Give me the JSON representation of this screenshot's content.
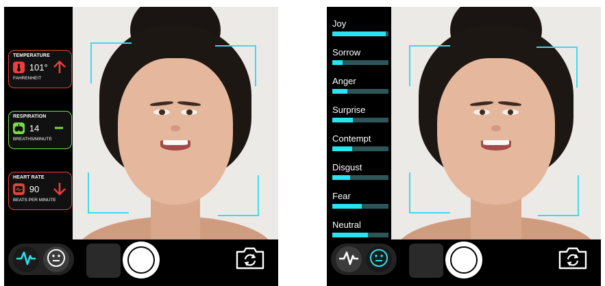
{
  "vitals_screen": {
    "temperature": {
      "title": "TEMPERATURE",
      "value": "101°",
      "unit": "FAHRENHEIT",
      "trend": "up-arrow-icon"
    },
    "respiration": {
      "title": "RESPIRATION",
      "value": "14",
      "unit": "BREATHS/MINUTE",
      "trend": "dash-icon"
    },
    "heart_rate": {
      "title": "HEART RATE",
      "value": "90",
      "unit": "BEATS PER MINUTE",
      "trend": "down-arrow-icon"
    }
  },
  "emotions_screen": {
    "emotions": [
      {
        "label": "Joy",
        "level": 0.95
      },
      {
        "label": "Sorrow",
        "level": 0.18
      },
      {
        "label": "Anger",
        "level": 0.27
      },
      {
        "label": "Surprise",
        "level": 0.37
      },
      {
        "label": "Contempt",
        "level": 0.35
      },
      {
        "label": "Disgust",
        "level": 0.32
      },
      {
        "label": "Fear",
        "level": 0.53
      },
      {
        "label": "Neutral",
        "level": 0.63
      }
    ]
  },
  "controls": {
    "vitals_mode_icon": "heartbeat-icon",
    "emotion_mode_icon": "neutral-face-icon",
    "capture_icon": "shutter-icon",
    "flip_icon": "flip-camera-icon"
  },
  "colors": {
    "accent": "#27e4ef",
    "alert": "#ee3d3d",
    "ok": "#78dd4a",
    "frame": "#3fd9ea"
  }
}
